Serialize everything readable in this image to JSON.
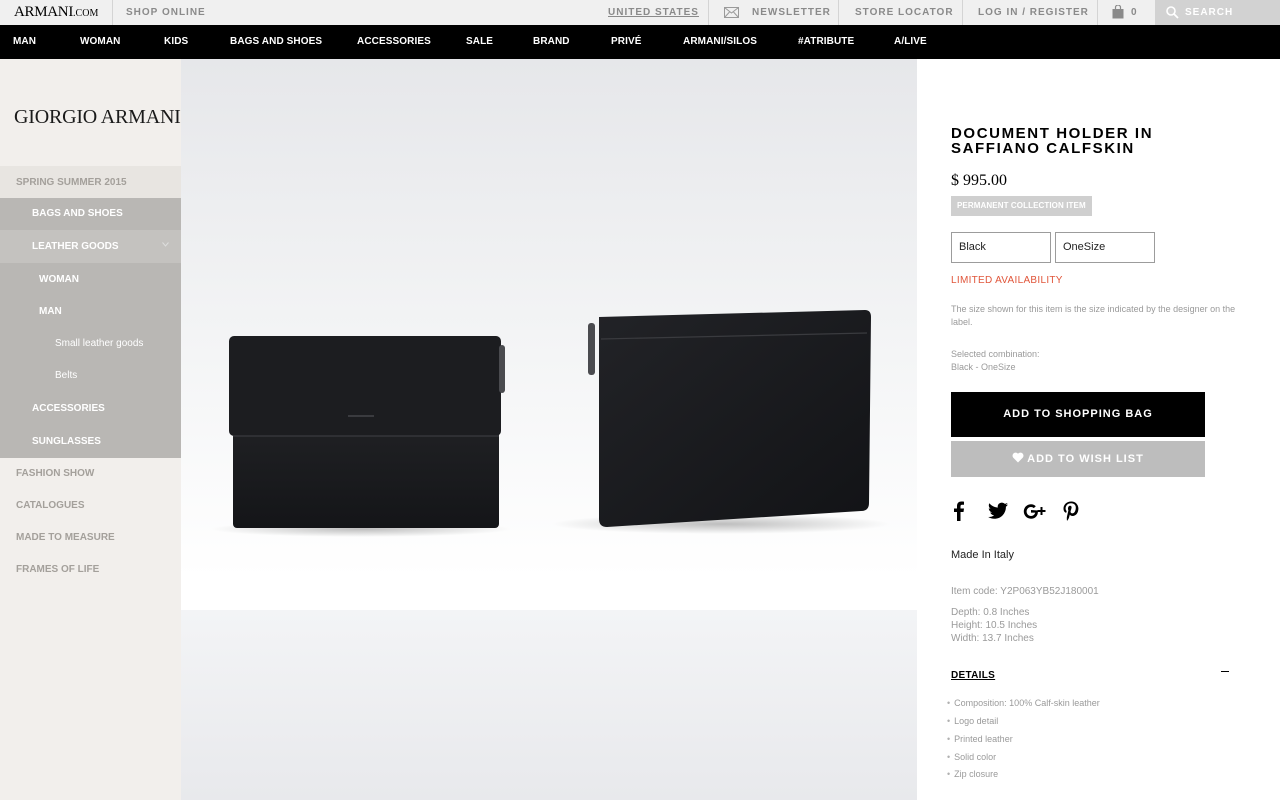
{
  "topbar": {
    "logo_main": "ARMANI",
    "logo_suffix": ".COM",
    "shop_online": "SHOP ONLINE",
    "country": "UNITED STATES",
    "newsletter": "NEWSLETTER",
    "store_locator": "STORE LOCATOR",
    "login": "LOG IN / REGISTER",
    "bag_count": "0",
    "search": "SEARCH"
  },
  "nav": [
    "MAN",
    "WOMAN",
    "KIDS",
    "BAGS AND SHOES",
    "ACCESSORIES",
    "SALE",
    "BRAND",
    "PRIVÉ",
    "ARMANI/SILOS",
    "#ATRIBUTE",
    "A/LIVE"
  ],
  "sidebar": {
    "brand": "GIORGIO ARMANI",
    "items": [
      {
        "label": "SPRING SUMMER 2015"
      },
      {
        "label": "BAGS AND SHOES"
      },
      {
        "label": "LEATHER GOODS"
      },
      {
        "label": "WOMAN"
      },
      {
        "label": "MAN"
      },
      {
        "label": "Small leather goods"
      },
      {
        "label": "Belts"
      },
      {
        "label": "ACCESSORIES"
      },
      {
        "label": "SUNGLASSES"
      },
      {
        "label": "FASHION SHOW"
      },
      {
        "label": "CATALOGUES"
      },
      {
        "label": "MADE TO MEASURE"
      },
      {
        "label": "FRAMES OF LIFE"
      }
    ]
  },
  "product": {
    "title": "DOCUMENT HOLDER IN SAFFIANO CALFSKIN",
    "price": "$ 995.00",
    "badge": "PERMANENT COLLECTION ITEM",
    "color": "Black",
    "size": "OneSize",
    "availability": "LIMITED AVAILABILITY",
    "size_note": "The size shown for this item is the size indicated by the designer on the label.",
    "selected_label": "Selected combination:",
    "selected_value": "Black - OneSize",
    "add_to_bag": "ADD TO SHOPPING BAG",
    "add_to_wishlist": "ADD TO WISH LIST",
    "made_in": "Made In Italy",
    "item_code": "Item code: Y2P063YB52J180001",
    "depth": "Depth:  0.8  Inches",
    "height": "Height:  10.5  Inches",
    "width": "Width:  13.7  Inches",
    "details_heading": "DETAILS",
    "details": [
      "Composition:  100% Calf-skin leather",
      "Logo detail",
      "Printed leather",
      "Solid color",
      "Zip closure"
    ]
  },
  "colors": {
    "nav_bg": "#000000",
    "topbar_bg": "#f0f0f0",
    "sidebar_bg": "#f2efec",
    "sidebar_active_bg": "#b9b7b4",
    "availability": "#e0553a",
    "wishlist_bg": "#bdbdbd"
  }
}
